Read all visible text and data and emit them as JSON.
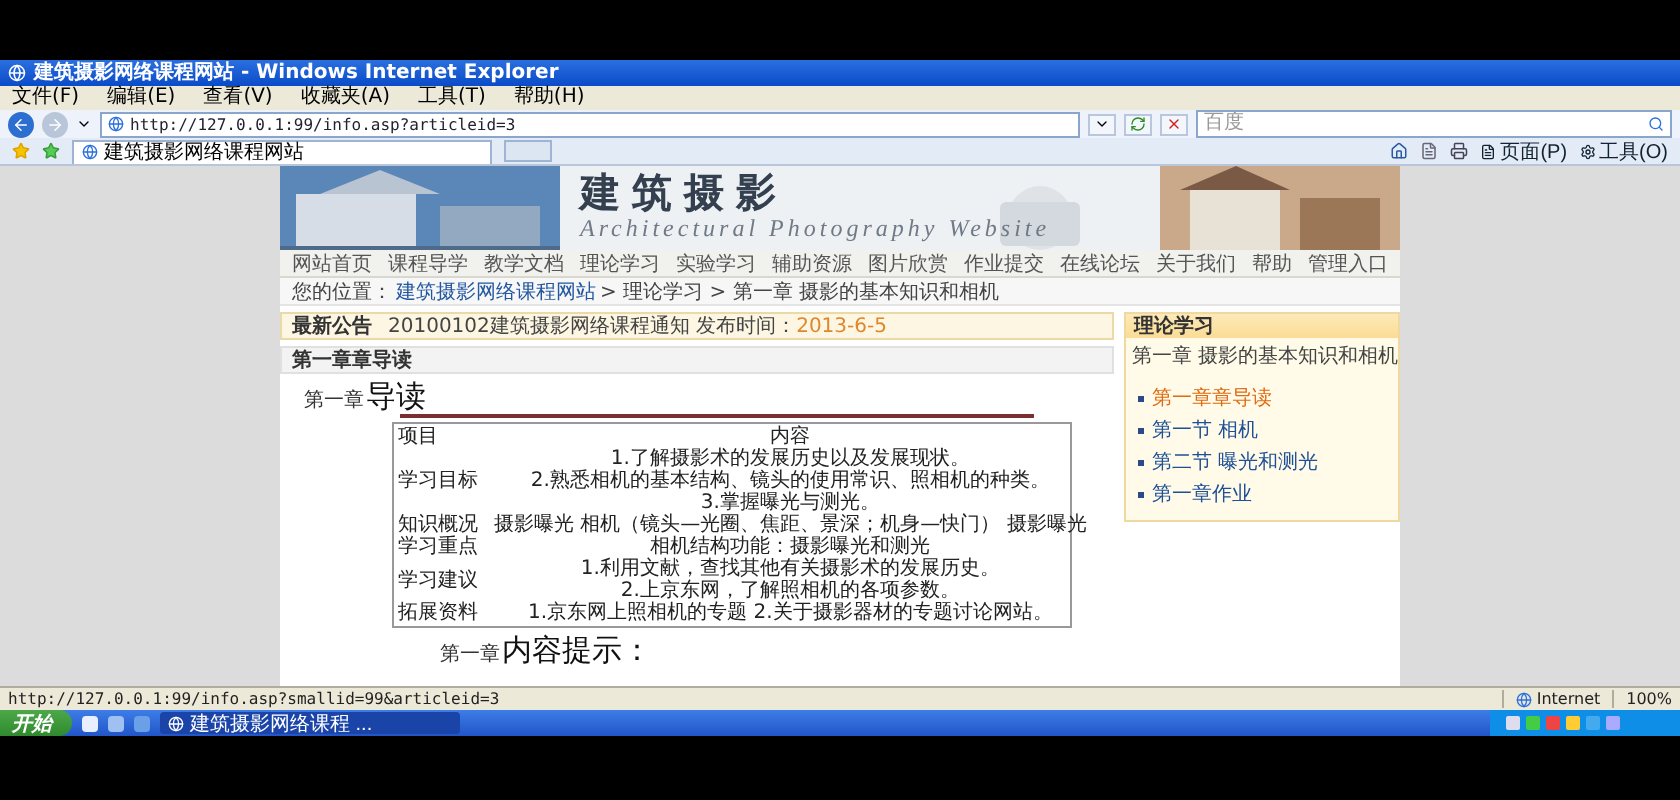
{
  "window": {
    "title": "建筑摄影网络课程网站 - Windows Internet Explorer"
  },
  "menu": [
    "文件(F)",
    "编辑(E)",
    "查看(V)",
    "收藏夹(A)",
    "工具(T)",
    "帮助(H)"
  ],
  "address_bar": {
    "url": "http://127.0.0.1:99/info.asp?articleid=3"
  },
  "search_field": {
    "placeholder": "百度"
  },
  "tab": {
    "title": "建筑摄影网络课程网站"
  },
  "toolbar": [
    "页面(P)",
    "工具(O)"
  ],
  "site": {
    "banner": {
      "title": "建筑摄影",
      "subtitle": "Architectural Photography Website"
    },
    "nav": [
      "网站首页",
      "课程导学",
      "教学文档",
      "理论学习",
      "实验学习",
      "辅助资源",
      "图片欣赏",
      "作业提交",
      "在线论坛",
      "关于我们",
      "帮助",
      "管理入口"
    ],
    "breadcrumb": {
      "prefix": "您的位置：",
      "link": "建筑摄影网络课程网站",
      "rest": "> 理论学习 > 第一章 摄影的基本知识和相机"
    },
    "notice": {
      "label": "最新公告",
      "text": "20100102建筑摄影网络课程通知 发布时间：",
      "date": "2013-6-5"
    },
    "panel_title": "第一章章导读",
    "heading": {
      "prefix": "第一章",
      "title": "导读"
    },
    "table": {
      "columns": [
        "项目",
        "内容"
      ],
      "rows": [
        {
          "label": "学习目标",
          "lines": [
            "1.了解摄影术的发展历史以及发展现状。",
            "2.熟悉相机的基本结构、镜头的使用常识、照相机的种类。",
            "3.掌握曝光与测光。"
          ]
        },
        {
          "label": "知识概况",
          "lines": [
            "摄影曝光 相机（镜头—光圈、焦距、景深；机身—快门） 摄影曝光"
          ]
        },
        {
          "label": "学习重点",
          "lines": [
            "相机结构功能：摄影曝光和测光"
          ]
        },
        {
          "label": "学习建议",
          "lines": [
            "1.利用文献，查找其他有关摄影术的发展历史。",
            "2.上京东网，了解照相机的各项参数。"
          ]
        },
        {
          "label": "拓展资料",
          "lines": [
            "1.京东网上照相机的专题 2.关于摄影器材的专题讨论网站。"
          ]
        }
      ]
    },
    "next_heading": {
      "prefix": "第一章",
      "title": "内容提示："
    },
    "sidebar": {
      "title": "理论学习",
      "subtitle": "第一章 摄影的基本知识和相机",
      "items": [
        {
          "label": "第一章章导读",
          "selected": true
        },
        {
          "label": "第一节 相机",
          "selected": false
        },
        {
          "label": "第二节 曝光和测光",
          "selected": false
        },
        {
          "label": "第一章作业",
          "selected": false
        }
      ]
    }
  },
  "status_bar": {
    "url": "http://127.0.0.1:99/info.asp?smallid=99&articleid=3",
    "zone": "Internet",
    "zoom": "100%"
  },
  "taskbar": {
    "start": "开始",
    "windows": [
      {
        "label": "建筑摄影网络课程 ...",
        "selected": true
      }
    ]
  }
}
